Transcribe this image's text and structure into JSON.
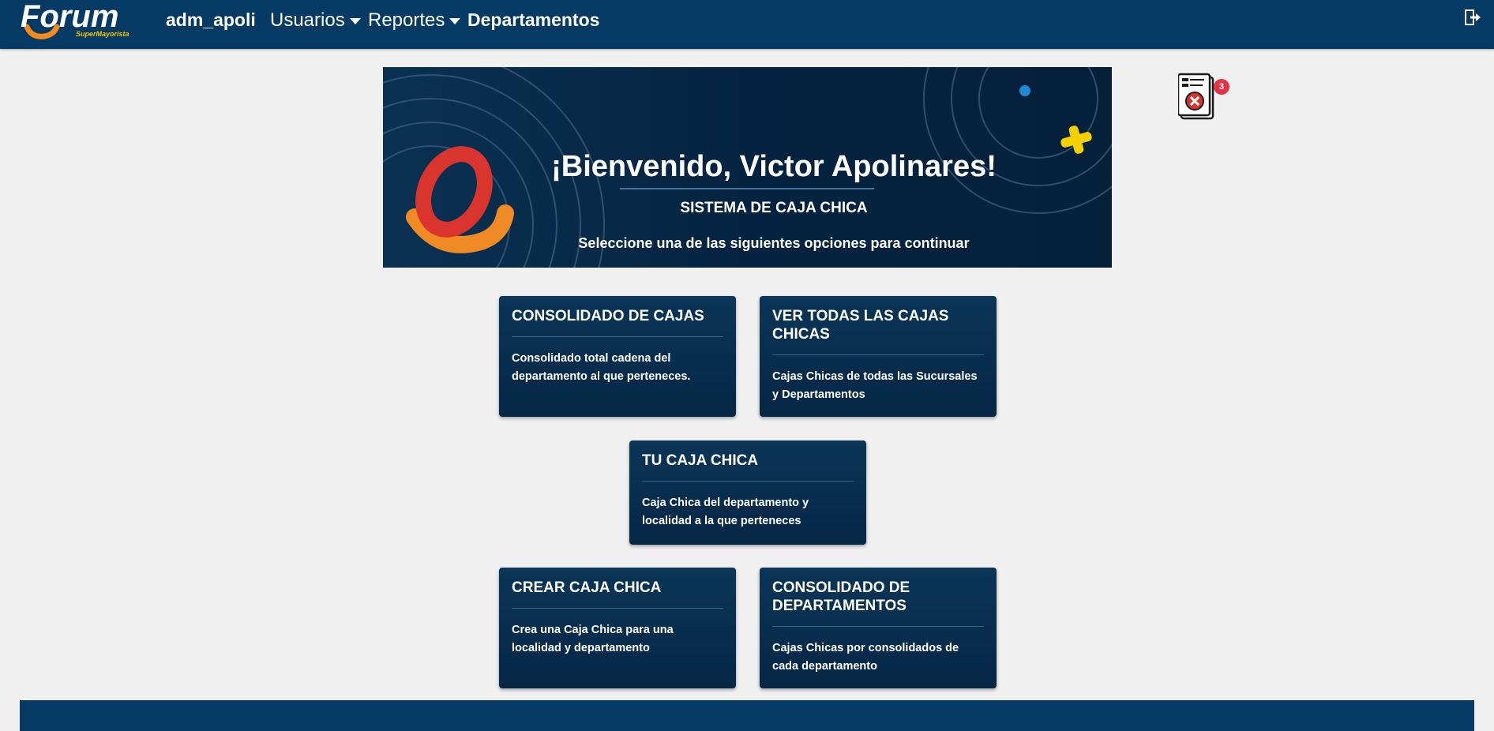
{
  "navbar": {
    "logo_text": "Forum",
    "logo_subtext": "SuperMayorista",
    "username": "adm_apoli",
    "menu_usuarios": "Usuarios",
    "menu_reportes": "Reportes",
    "menu_departamentos": "Departamentos",
    "logout_icon": "logout-icon"
  },
  "banner": {
    "title": "¡Bienvenido, Victor Apolinares!",
    "subtitle": "SISTEMA DE CAJA CHICA",
    "instruction": "Seleccione una de las siguientes opciones para continuar"
  },
  "notification": {
    "icon": "rejected-document-icon",
    "count": "3",
    "badge_color": "#e03546"
  },
  "cards": [
    {
      "title": "CONSOLIDADO DE CAJAS",
      "description": "Consolidado total cadena del departamento al que perteneces."
    },
    {
      "title": "VER TODAS LAS CAJAS CHICAS",
      "description": "Cajas Chicas de todas las Sucursales y Departamentos"
    },
    {
      "title": "TU CAJA CHICA",
      "description": "Caja Chica del departamento y localidad a la que perteneces"
    },
    {
      "title": "CREAR CAJA CHICA",
      "description": "Crea una Caja Chica para una localidad y departamento"
    },
    {
      "title": "CONSOLIDADO DE DEPARTAMENTOS",
      "description": "Cajas Chicas por consolidados de cada departamento"
    }
  ],
  "colors": {
    "navbar": "#043a63",
    "card": "#062645",
    "background": "#f0f0f0"
  }
}
